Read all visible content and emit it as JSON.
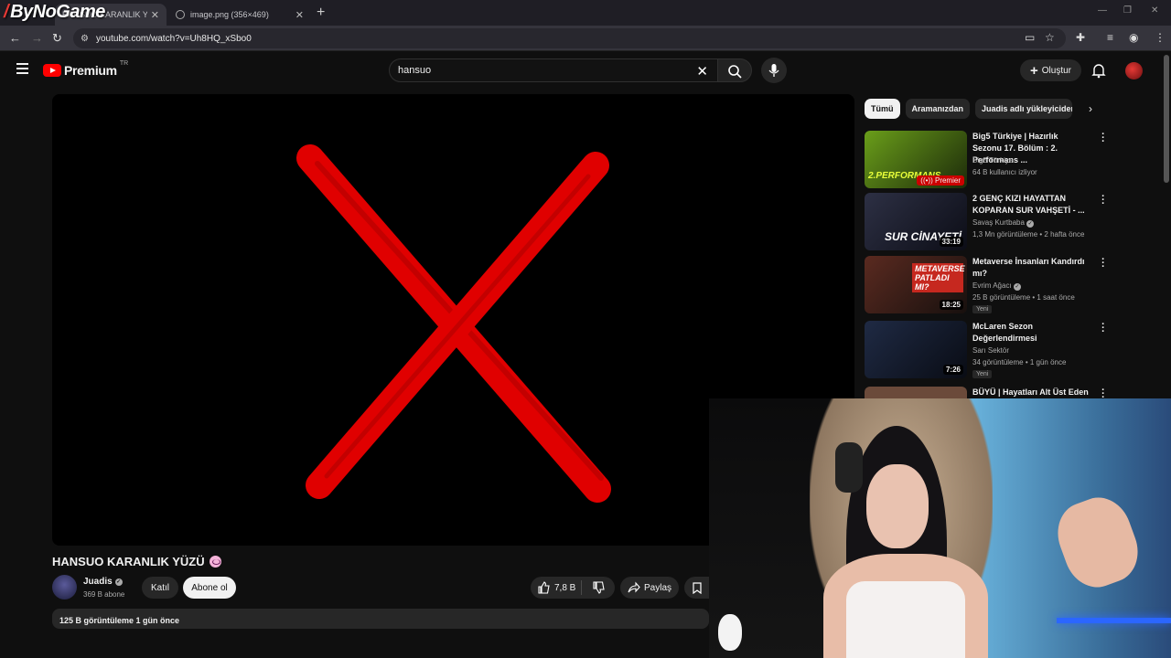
{
  "browser": {
    "overlay_logo": "ByNoGame",
    "tabs": [
      {
        "title": "HANSUO KARANLIK YÜZÜ",
        "active": true
      },
      {
        "title": "image.png (356×469)",
        "active": false
      }
    ],
    "address": "youtube.com/watch?v=Uh8HQ_xSbo0"
  },
  "header": {
    "brand": "Premium",
    "country": "TR",
    "search_query": "hansuo",
    "create_label": "Oluştur"
  },
  "video": {
    "title": "HANSUO KARANLIK YÜZÜ",
    "channel": "Juadis",
    "subscribers": "369 B abone",
    "join_label": "Katıl",
    "subscribe_label": "Abone ol",
    "likes": "7,8 B",
    "share_label": "Paylaş",
    "views_date": "125 B görüntüleme  1 gün önce",
    "accent_color": "#e00000"
  },
  "sidebar": {
    "chips": [
      "Tümü",
      "Aramanızdan",
      "Juadis adlı yükleyiciden"
    ],
    "recommendations": [
      {
        "title": "Big5 Türkiye | Hazırlık Sezonu 17. Bölüm : 2. Performans ...",
        "channel": "Big5 Türkiye",
        "meta": "64 B kullanıcı izliyor",
        "overlay": "Premier",
        "thumb_text": "2.PERFORMANS"
      },
      {
        "title": "2 GENÇ KIZI HAYATTAN KOPARAN SUR VAHŞETİ - ...",
        "channel": "Savaş Kurtbaba",
        "meta": "1,3 Mn görüntüleme • 2 hafta önce",
        "overlay": "33:19",
        "thumb_text": "SUR CİNAYETİ"
      },
      {
        "title": "Metaverse İnsanları Kandırdı mı?",
        "channel": "Evrim Ağacı",
        "meta": "25 B görüntüleme • 1 saat önce",
        "overlay": "18:25",
        "badge": "Yeni",
        "thumb_text": "METAVERSE PATLADI MI?"
      },
      {
        "title": "McLaren Sezon Değerlendirmesi",
        "channel": "Sarı Sektör",
        "meta": "34 görüntüleme • 1 gün önce",
        "overlay": "7:26",
        "badge": "Yeni",
        "thumb_text": ""
      },
      {
        "title": "BÜYÜ | Hayatları Alt Üst Eden",
        "channel": "",
        "meta": "",
        "overlay": "",
        "thumb_text": ""
      }
    ]
  }
}
